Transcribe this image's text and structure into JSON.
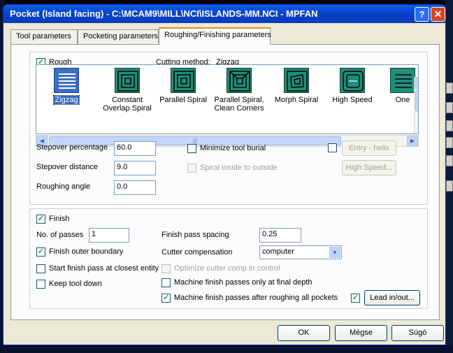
{
  "window": {
    "title": "Pocket (Island facing) - C:\\MCAM9\\MILL\\NCI\\ISLANDS-MM.NCI - MPFAN",
    "help_glyph": "?",
    "close_glyph": "✕"
  },
  "tabs": [
    "Tool parameters",
    "Pocketing parameters",
    "Roughing/Finishing parameters"
  ],
  "rough": {
    "label": "Rough",
    "checked": true,
    "cutting_method_label": "Cutting method:",
    "cutting_method_value": "Zigzag",
    "methods": [
      {
        "line1": "Zigzag",
        "line2": "",
        "icon": "zigzag-icon"
      },
      {
        "line1": "Constant",
        "line2": "Overlap Spiral",
        "icon": "constant-overlap-spiral-icon"
      },
      {
        "line1": "Parallel Spiral",
        "line2": "",
        "icon": "parallel-spiral-icon"
      },
      {
        "line1": "Parallel Spiral,",
        "line2": "Clean Corners",
        "icon": "parallel-spiral-clean-corners-icon"
      },
      {
        "line1": "Morph Spiral",
        "line2": "",
        "icon": "morph-spiral-icon"
      },
      {
        "line1": "High Speed",
        "line2": "",
        "icon": "high-speed-icon"
      },
      {
        "line1": "One",
        "line2": "",
        "icon": "one-way-icon"
      }
    ],
    "stepover_percentage_label": "Stepover percentage",
    "stepover_percentage": "60.0",
    "stepover_distance_label": "Stepover distance",
    "stepover_distance": "9.0",
    "roughing_angle_label": "Roughing angle",
    "roughing_angle": "0.0",
    "minimize_tool_burial": "Minimize tool burial",
    "spiral_inside_to_outside": "Spiral inside to outside",
    "entry_helix": "Entry - helix",
    "high_speed_btn": "High Speed..."
  },
  "finish": {
    "label": "Finish",
    "checked": true,
    "passes_label": "No. of passes",
    "passes": "1",
    "spacing_label": "Finish pass spacing",
    "spacing": "0.25",
    "outer_boundary": "Finish outer boundary",
    "outer_boundary_checked": true,
    "cutter_comp_label": "Cutter compensation",
    "cutter_comp": "computer",
    "start_closest": "Start finish pass at closest entity",
    "optimize_comp": "Optimize cutter comp in control",
    "keep_tool_down": "Keep tool down",
    "final_depth": "Machine finish passes only at final depth",
    "after_roughing": "Machine finish passes after roughing all pockets",
    "after_roughing_checked": true,
    "lead_checked": true,
    "lead_btn": "Lead in/out..."
  },
  "buttons": {
    "ok": "OK",
    "cancel": "Mégse",
    "help": "Súgó"
  },
  "glyphs": {
    "check": "✓",
    "left": "◀",
    "right": "▶",
    "up": "▲",
    "down": "▼",
    "grip": "|||"
  },
  "colors": {
    "title_bar": "#0840c8",
    "icon_teal": "#1e8f7a",
    "selection": "#316ac5"
  }
}
